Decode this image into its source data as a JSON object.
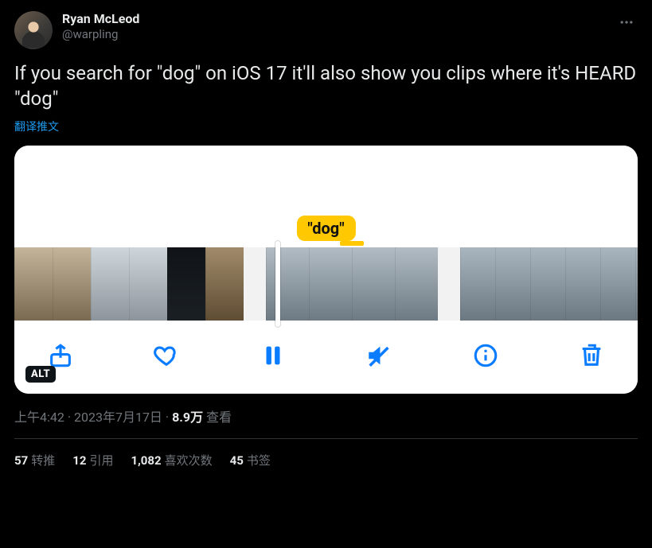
{
  "author": {
    "display_name": "Ryan McLeod",
    "handle": "@warpling"
  },
  "tweet_text": "If you search for \"dog\" on iOS 17 it'll also show you clips where it's HEARD \"dog\"",
  "translate_label": "翻译推文",
  "media": {
    "highlight_label": "\"dog\"",
    "alt_badge": "ALT"
  },
  "meta": {
    "time": "上午4:42",
    "date": "2023年7月17日",
    "views_number": "8.9万",
    "views_label": "查看",
    "separator": " · "
  },
  "stats": {
    "retweets": {
      "num": "57",
      "label": "转推"
    },
    "quotes": {
      "num": "12",
      "label": "引用"
    },
    "likes": {
      "num": "1,082",
      "label": "喜欢次数"
    },
    "bookmarks": {
      "num": "45",
      "label": "书签"
    }
  }
}
